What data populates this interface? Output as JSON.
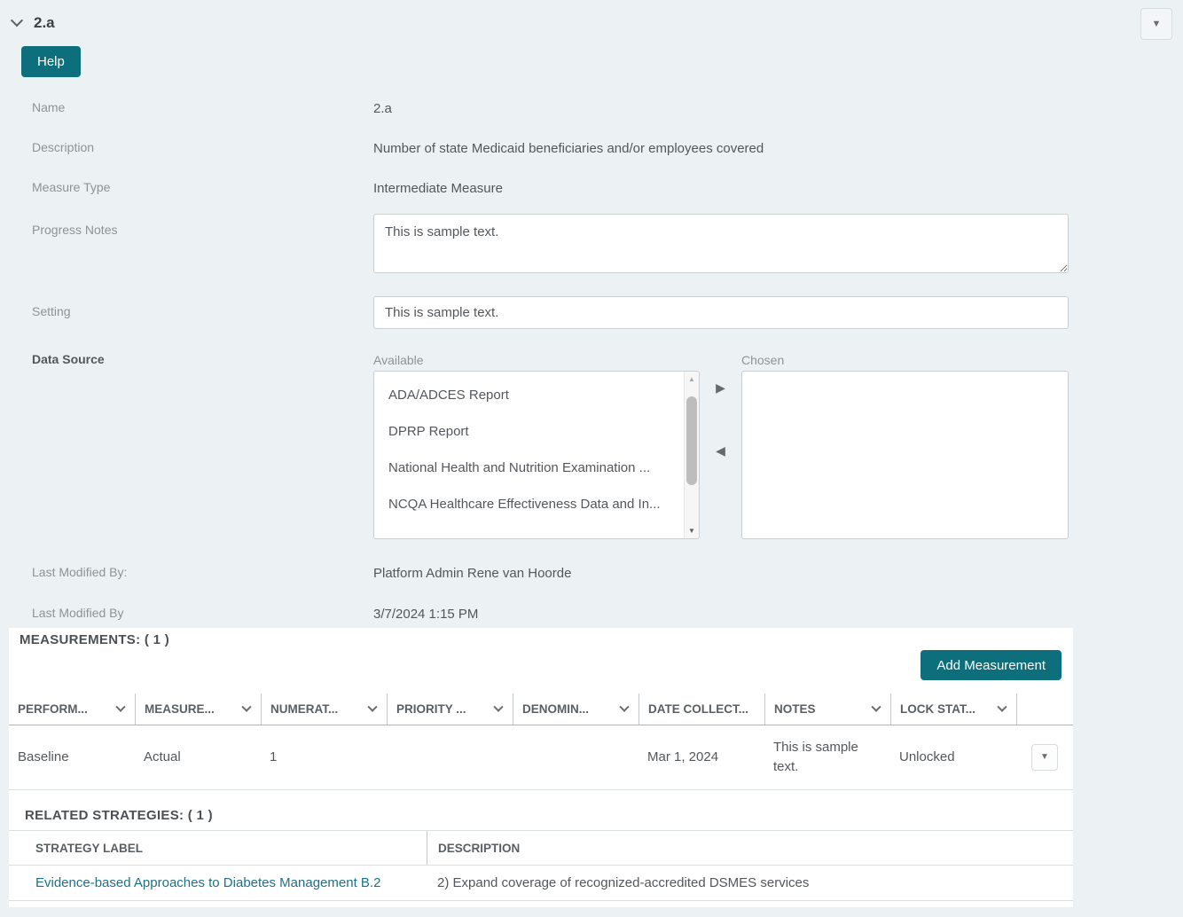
{
  "colors": {
    "page_bg": "#ecf1f4",
    "accent_teal": "#0d6e7c",
    "link_teal": "#1d7088"
  },
  "icons": {
    "collapse_chevron": "chevron-down (css)",
    "sort_chevron": "chevron-down (css)",
    "dropdown_caret": "▼",
    "move_right_arrow": "▶",
    "move_left_arrow": "◀",
    "scroll_up_arrow": "▲",
    "scroll_down_arrow": "▼"
  },
  "header": {
    "title": "2.a",
    "help_button": "Help"
  },
  "form": {
    "name": {
      "label": "Name",
      "value": "2.a"
    },
    "description": {
      "label": "Description",
      "value": "Number of state Medicaid beneficiaries and/or employees covered"
    },
    "measure_type": {
      "label": "Measure Type",
      "value": "Intermediate Measure"
    },
    "progress_notes": {
      "label": "Progress Notes",
      "value": "This is sample text."
    },
    "setting": {
      "label": "Setting",
      "value": "This is sample text."
    },
    "data_source": {
      "label": "Data Source",
      "available_label": "Available",
      "chosen_label": "Chosen",
      "available_items": [
        "ADA/ADCES Report",
        "DPRP Report",
        "National Health and Nutrition Examination ...",
        "NCQA Healthcare Effectiveness Data and In..."
      ],
      "chosen_items": []
    },
    "last_modified_by": {
      "label": "Last Modified By:",
      "value": "Platform Admin Rene van Hoorde"
    },
    "last_modified_date": {
      "label": "Last Modified By",
      "value": "3/7/2024 1:15 PM"
    }
  },
  "measurements": {
    "heading": "MEASUREMENTS: ( 1 )",
    "add_button": "Add Measurement",
    "columns": [
      {
        "label": "PERFORM..."
      },
      {
        "label": "MEASURE..."
      },
      {
        "label": "NUMERAT..."
      },
      {
        "label": "PRIORITY ..."
      },
      {
        "label": "DENOMIN..."
      },
      {
        "label": "DATE COLLECT..."
      },
      {
        "label": "NOTES"
      },
      {
        "label": "LOCK STAT..."
      }
    ],
    "row": {
      "performance": "Baseline",
      "measure": "Actual",
      "numerator": "1",
      "priority": "",
      "denominator": "",
      "date_collected": "Mar 1, 2024",
      "notes": "This is sample text.",
      "lock_status": "Unlocked"
    }
  },
  "related_strategies": {
    "heading": "RELATED STRATEGIES: ( 1 )",
    "columns": {
      "strategy_label": "STRATEGY LABEL",
      "description": "DESCRIPTION"
    },
    "row": {
      "strategy_label": "Evidence-based Approaches to Diabetes Management B.2",
      "description": "2) Expand coverage of recognized-accredited DSMES services"
    }
  }
}
